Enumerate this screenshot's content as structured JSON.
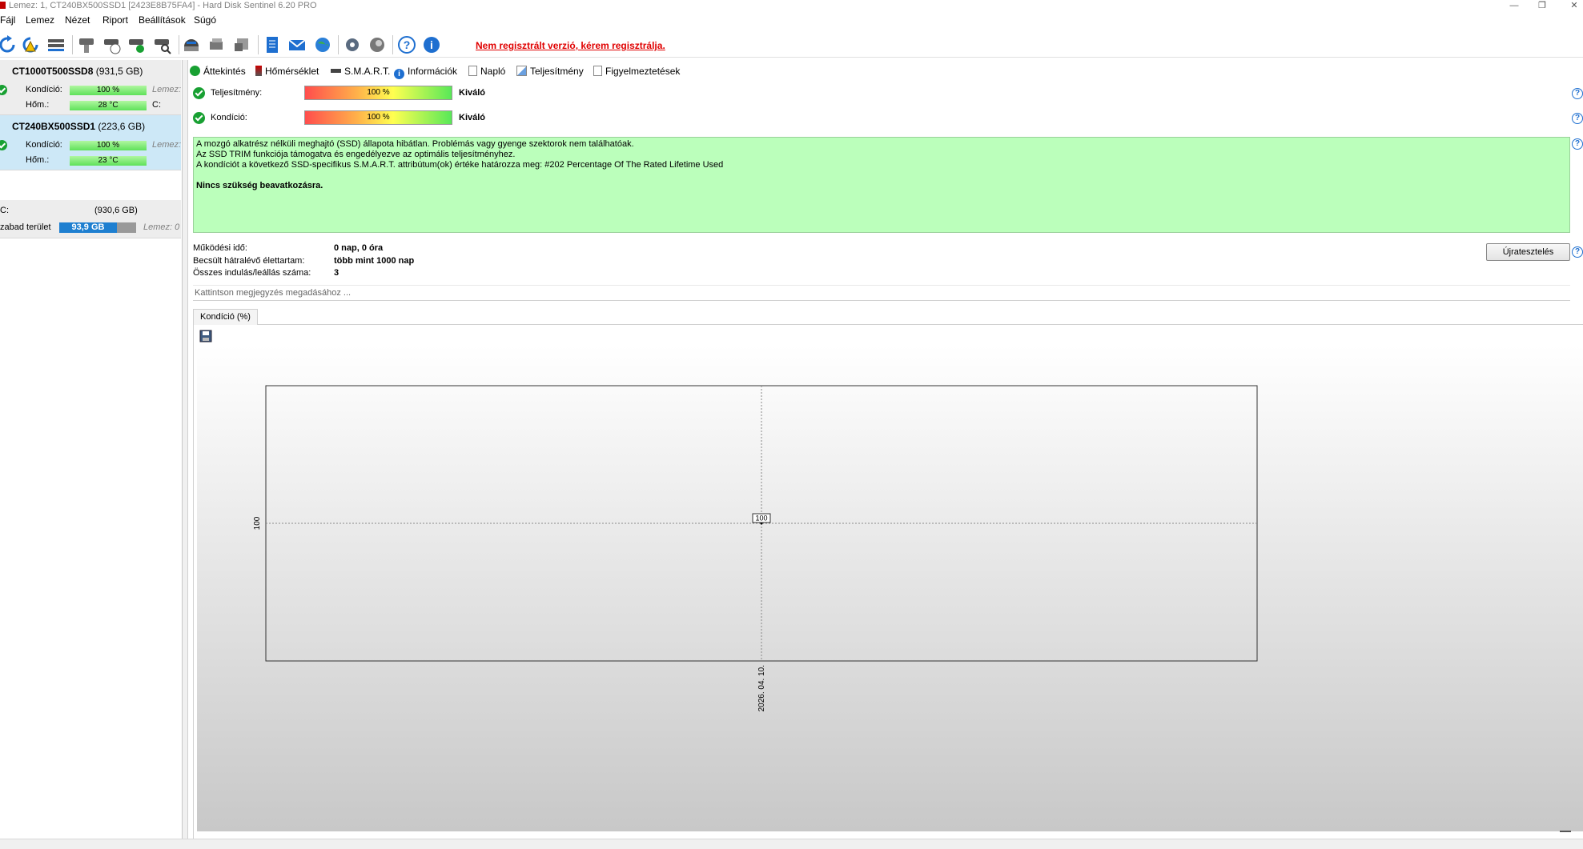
{
  "window": {
    "title": "Lemez: 1, CT240BX500SSD1 [2423E8B75FA4]  -  Hard Disk Sentinel 6.20 PRO"
  },
  "menu": [
    "Fájl",
    "Lemez",
    "Nézet",
    "Riport",
    "Beállítások",
    "Súgó"
  ],
  "toolbar": {
    "icons": [
      "refresh-icon",
      "refresh-warning-icon",
      "disk-list-icon",
      "disk-icon",
      "disk-clock-icon",
      "disk-check-icon",
      "disk-search-icon",
      "disk-surface-icon",
      "disk-tools-icon",
      "disk-drive-icon",
      "report-icon",
      "email-icon",
      "web-icon",
      "settings-icon",
      "sound-icon",
      "help-icon",
      "info-icon"
    ],
    "registration_message": "Nem regisztrált verzió, kérem regisztrálja."
  },
  "disks": [
    {
      "name": "CT1000T500SSD8",
      "size": "(931,5 GB)",
      "condition_label": "Kondíció:",
      "condition_value": "100 %",
      "temp_label": "Hőm.:",
      "temp_value": "28 °C",
      "extra1": "Lemez:",
      "extra2": "C:"
    },
    {
      "name": "CT240BX500SSD1",
      "size": "(223,6 GB)",
      "condition_label": "Kondíció:",
      "condition_value": "100 %",
      "temp_label": "Hőm.:",
      "temp_value": "23 °C",
      "extra1": "Lemez:"
    }
  ],
  "volume": {
    "name": "C:",
    "size": "(930,6 GB)",
    "free_label": "zabad terület",
    "free_value": "93,9 GB",
    "free_fraction": 0.75,
    "disk_label": "Lemez: 0"
  },
  "tabs": [
    "Áttekintés",
    "Hőmérséklet",
    "S.M.A.R.T.",
    "Információk",
    "Napló",
    "Teljesítmény",
    "Figyelmeztetések"
  ],
  "status": {
    "performance_label": "Teljesítmény:",
    "performance_value": "100 %",
    "performance_rating": "Kiváló",
    "condition_label": "Kondíció:",
    "condition_value": "100 %",
    "condition_rating": "Kiváló"
  },
  "summary": {
    "line1": "A mozgó alkatrész nélküli meghajtó (SSD) állapota hibátlan. Problémás vagy gyenge szektorok nem találhatóak.",
    "line2": "Az SSD TRIM funkciója támogatva és engedélyezve az optimális teljesítményhez.",
    "line3": "A kondíciót a következő SSD-specifikus S.M.A.R.T. attribútum(ok) értéke határozza meg:  #202 Percentage Of The Rated Lifetime Used",
    "bold_line": "Nincs szükség beavatkozásra."
  },
  "info": {
    "uptime_label": "Működési idő:",
    "uptime_value": "0 nap, 0 óra",
    "lifetime_label": "Becsült hátralévő élettartam:",
    "lifetime_value": "több mint 1000 nap",
    "starts_label": "Összes indulás/leállás száma:",
    "starts_value": "3"
  },
  "retest_button": "Újratesztelés",
  "note_placeholder": "Kattintson megjegyzés megadásához ...",
  "chart_tab": "Kondíció  (%)",
  "chart_data": {
    "type": "line",
    "x": [
      "2026. 04. 10."
    ],
    "series": [
      {
        "values": [
          100
        ]
      }
    ],
    "data_labels": [
      "100"
    ],
    "ytick_labels": [
      "100"
    ],
    "xtick_labels": [
      "2026. 04. 10."
    ],
    "grid": true
  }
}
